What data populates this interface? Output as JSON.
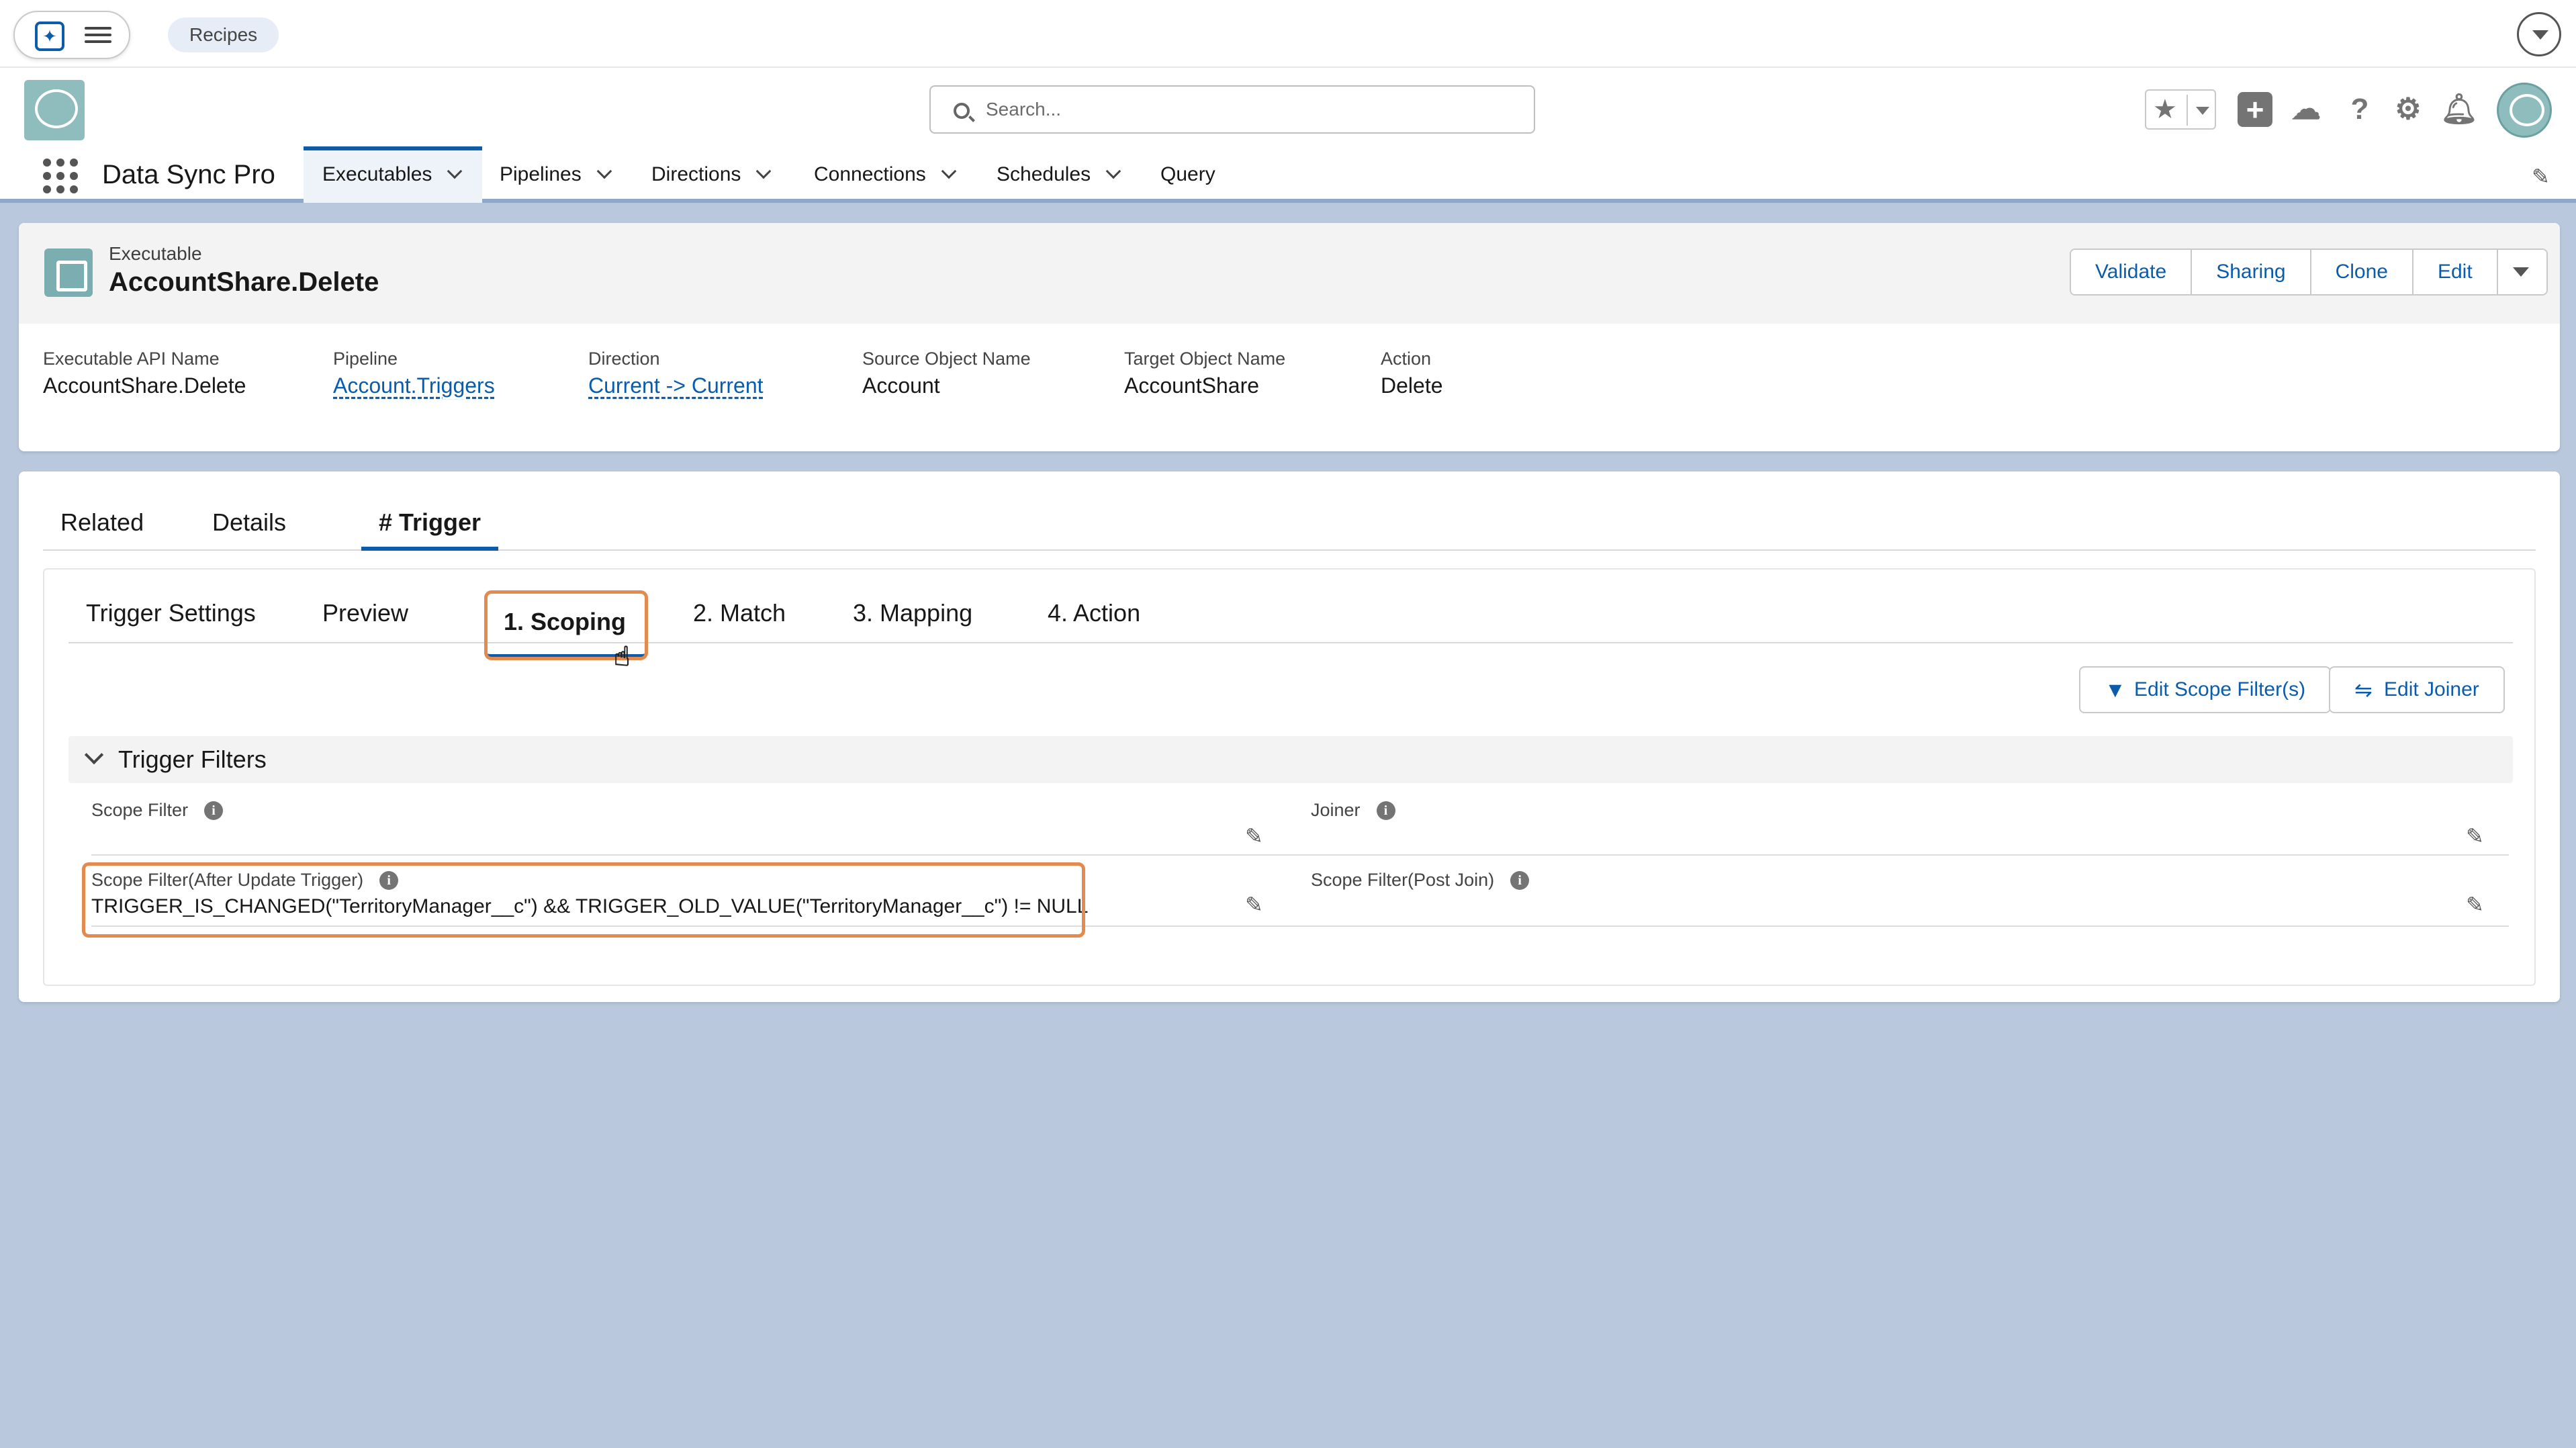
{
  "topbar": {
    "recipes_label": "Recipes"
  },
  "header": {
    "search_placeholder": "Search..."
  },
  "nav": {
    "app_name": "Data Sync Pro",
    "items": [
      {
        "label": "Executables",
        "active": true
      },
      {
        "label": "Pipelines"
      },
      {
        "label": "Directions"
      },
      {
        "label": "Connections"
      },
      {
        "label": "Schedules"
      },
      {
        "label": "Query"
      }
    ]
  },
  "record": {
    "type": "Executable",
    "title": "AccountShare.Delete",
    "actions": [
      "Validate",
      "Sharing",
      "Clone",
      "Edit"
    ],
    "fields": [
      {
        "label": "Executable API Name",
        "value": "AccountShare.Delete"
      },
      {
        "label": "Pipeline",
        "value": "Account.Triggers"
      },
      {
        "label": "Direction",
        "value": "Current -> Current"
      },
      {
        "label": "Source Object Name",
        "value": "Account"
      },
      {
        "label": "Target Object Name",
        "value": "AccountShare"
      },
      {
        "label": "Action",
        "value": "Delete"
      }
    ]
  },
  "tabs": [
    "Related",
    "Details",
    "# Trigger"
  ],
  "subtabs": [
    "Trigger Settings",
    "Preview",
    "1. Scoping",
    "2. Match",
    "3. Mapping",
    "4. Action"
  ],
  "buttons": {
    "edit_scope": "Edit Scope Filter(s)",
    "edit_joiner": "Edit Joiner"
  },
  "section": {
    "title": "Trigger Filters",
    "scope_filter_label": "Scope Filter",
    "scope_filter_value": "",
    "joiner_label": "Joiner",
    "joiner_value": "",
    "after_update_label": "Scope Filter(After Update Trigger)",
    "after_update_value": "TRIGGER_IS_CHANGED(\"TerritoryManager__c\") && TRIGGER_OLD_VALUE(\"TerritoryManager__c\") != NULL",
    "post_join_label": "Scope Filter(Post Join)",
    "post_join_value": ""
  },
  "colors": {
    "brand": "#0b5cab",
    "highlight": "#e58a4e",
    "background": "#b9c8dd"
  }
}
